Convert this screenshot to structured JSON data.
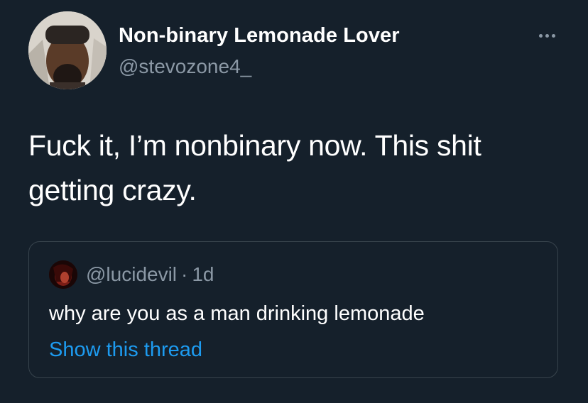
{
  "tweet": {
    "author": {
      "display_name": "Non-binary Lemonade Lover",
      "handle": "@stevozone4_",
      "avatar_icon": "profile-photo"
    },
    "more_icon": "more-options-icon",
    "text": "Fuck it, I’m nonbinary now. This shit getting crazy.",
    "quoted_tweet": {
      "handle": "@lucidevil",
      "separator": "·",
      "time": "1d",
      "avatar_icon": "profile-photo",
      "text": "why are you as a man drinking lemonade",
      "show_thread_label": "Show this thread"
    }
  },
  "colors": {
    "background": "#15202b",
    "primary_text": "#ffffff",
    "secondary_text": "#8b98a5",
    "link": "#1d9bf0",
    "border": "#38444d"
  }
}
